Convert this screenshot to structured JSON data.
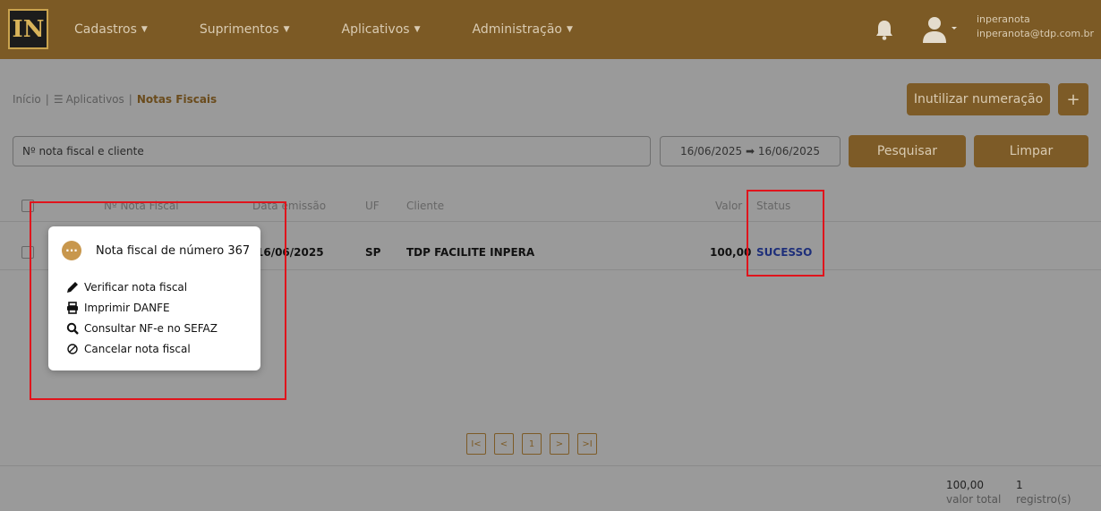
{
  "header": {
    "logo_text": "IN",
    "nav": [
      {
        "label": "Cadastros"
      },
      {
        "label": "Suprimentos"
      },
      {
        "label": "Aplicativos"
      },
      {
        "label": "Administração"
      }
    ],
    "user": {
      "name": "inperanota",
      "email": "inperanota@tdp.com.br"
    }
  },
  "breadcrumb": {
    "home": "Início",
    "section": "Aplicativos",
    "current": "Notas Fiscais"
  },
  "actions": {
    "inutilizar_label": "Inutilizar numeração",
    "add_label": "+"
  },
  "filters": {
    "search_placeholder": "Nº nota fiscal e cliente",
    "date_range": "16/06/2025 ➡ 16/06/2025",
    "search_button": "Pesquisar",
    "clear_button": "Limpar"
  },
  "table": {
    "columns": {
      "numero": "Nº Nota Fiscal",
      "data": "Data emissão",
      "uf": "UF",
      "cliente": "Cliente",
      "valor": "Valor",
      "status": "Status"
    },
    "rows": [
      {
        "data": "16/06/2025",
        "uf": "SP",
        "cliente": "TDP FACILITE INPERA",
        "valor": "100,00",
        "status": "SUCESSO"
      }
    ]
  },
  "popup": {
    "title": "Nota fiscal de número 367",
    "items": [
      {
        "label": "Verificar nota fiscal",
        "icon": "pencil-icon"
      },
      {
        "label": "Imprimir DANFE",
        "icon": "printer-icon"
      },
      {
        "label": "Consultar NF-e no SEFAZ",
        "icon": "search-icon"
      },
      {
        "label": "Cancelar nota fiscal",
        "icon": "ban-icon"
      }
    ]
  },
  "pagination": {
    "first": "I<",
    "prev": "<",
    "page": "1",
    "next": ">",
    "last": ">I"
  },
  "totals": {
    "valor": "100,00",
    "valor_label": "valor total",
    "registros": "1",
    "registros_label": "registro(s)"
  },
  "colors": {
    "brand": "#7c5a25",
    "status_success": "#1e2f7a",
    "highlight": "#e0141c"
  }
}
